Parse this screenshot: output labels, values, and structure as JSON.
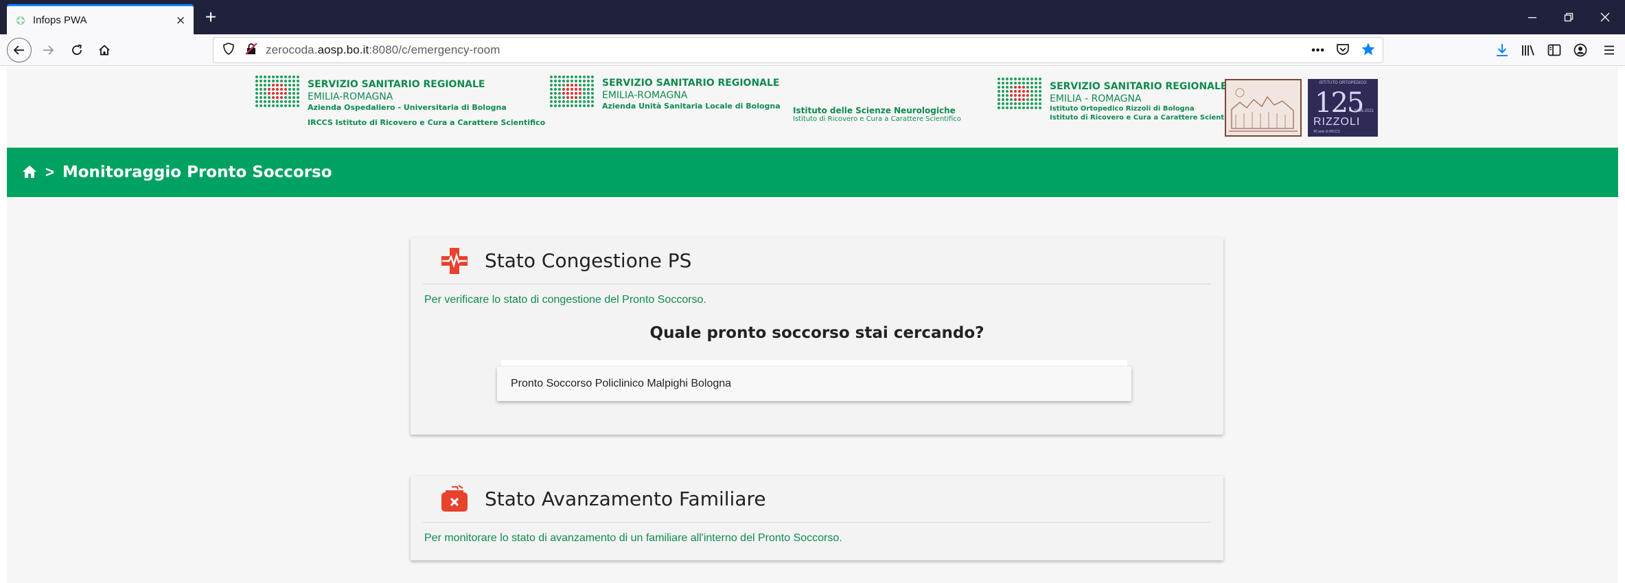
{
  "browser": {
    "tab_title": "Infops PWA",
    "new_tab_symbol": "+",
    "url_prefix": "zerocoda.",
    "url_host": "aosp.bo.it",
    "url_rest": ":8080/c/emergency-room",
    "page_actions_label": "•••"
  },
  "logos": {
    "block1": {
      "line1": "SERVIZIO SANITARIO REGIONALE",
      "line2": "EMILIA-ROMAGNA",
      "line3": "Azienda Ospedaliero - Universitaria di Bologna",
      "line4": "IRCCS Istituto di Ricovero e Cura a Carattere Scientifico"
    },
    "block2": {
      "line1": "SERVIZIO SANITARIO REGIONALE",
      "line2": "EMILIA-ROMAGNA",
      "line3": "Azienda Unità Sanitaria Locale di Bologna",
      "side1": "Istituto delle Scienze Neurologiche",
      "side2": "Istituto di Ricovero e Cura a Carattere Scientifico"
    },
    "block3": {
      "line1": "SERVIZIO SANITARIO REGIONALE",
      "line2": "EMILIA - ROMAGNA",
      "line3": "Istituto Ortopedico Rizzoli di Bologna",
      "line4": "Istituto di Ricovero e Cura a Carattere Scientifico"
    },
    "rizzoli": {
      "top": "ISTITUTO ORTOPEDICO",
      "number": "125",
      "name": "RIZZOLI",
      "years": "1896-2021",
      "sub": "40 anni di IRCCS"
    }
  },
  "breadcrumb": {
    "separator": ">",
    "title": "Monitoraggio Pronto Soccorso"
  },
  "card_congestion": {
    "title": "Stato Congestione PS",
    "description": "Per verificare lo stato di congestione del Pronto Soccorso.",
    "question": "Quale pronto soccorso stai cercando?",
    "option": "Pronto Soccorso Policlinico Malpighi Bologna"
  },
  "card_family": {
    "title": "Stato Avanzamento Familiare",
    "description": "Per monitorare lo stato di avanzamento di un familiare all'interno del Pronto Soccorso."
  },
  "colors": {
    "brand_green": "#00a261",
    "text_green": "#0f8a4e",
    "accent_red": "#e8412c",
    "tab_bar": "#20223c",
    "firefox_blue": "#0a84ff"
  },
  "icons": [
    "shield-icon",
    "insecure-lock-icon",
    "pocket-icon",
    "bookmark-star-icon",
    "download-icon",
    "library-icon",
    "sidebar-icon",
    "account-icon",
    "menu-icon",
    "home-icon",
    "medical-cross-icon",
    "first-aid-kit-icon"
  ]
}
